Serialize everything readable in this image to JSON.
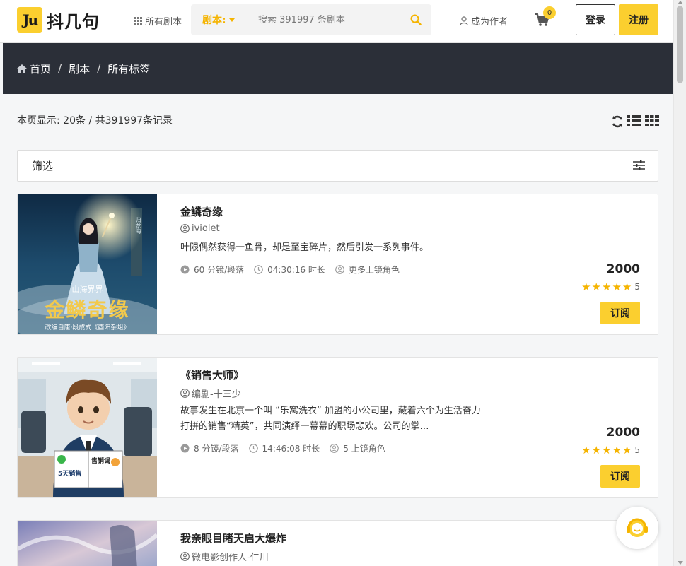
{
  "header": {
    "logo_mark": "Ju",
    "logo_text": "抖几句",
    "all_scripts_label": "所有剧本",
    "search_type": "剧本:",
    "search_placeholder": "搜索 391997 条剧本",
    "become_author_label": "成为作者",
    "cart_count": "0",
    "login_label": "登录",
    "register_label": "注册"
  },
  "breadcrumb": {
    "home": "首页",
    "level2": "剧本",
    "level3": "所有标签",
    "separator": "/"
  },
  "results_text": "本页显示: 20条 / 共391997条记录",
  "filter_label": "筛选",
  "cards": [
    {
      "title": "金鳞奇缘",
      "author": "iviolet",
      "description": "叶限偶然获得一鱼骨，却是至宝碎片，然后引发一系列事件。",
      "shots": "60 分镜/段落",
      "duration": "04:30:16 时长",
      "roles": "更多上镜角色",
      "price": "2000",
      "rating": "5",
      "subscribe_label": "订阅",
      "cover_caption_small": "山海界界",
      "cover_caption_big": "金鳞奇缘",
      "cover_caption_sub": "改编自唐·段成式《酉阳杂俎》",
      "cover_sign": "归龙海",
      "accent_color": "#f2c94c"
    },
    {
      "title": "《销售大师》",
      "author": "编剧-十三少",
      "description": "故事发生在北京一个叫 “乐窝洗衣” 加盟的小公司里，藏着六个为生活奋力打拼的销售“精英”，共同演绎一幕幕的职场悲欢。公司的掌…",
      "shots": "8 分镜/段落",
      "duration": "14:46:08 时长",
      "roles": "5 上镜角色",
      "price": "2000",
      "rating": "5",
      "subscribe_label": "订阅",
      "cover_book_left": "5天销售",
      "cover_book_right": "售销谒"
    },
    {
      "title": "我亲眼目睹天启大爆炸",
      "author": "微电影创作人-仁川"
    }
  ],
  "colors": {
    "accent": "#fbcf2f",
    "banner_bg": "#2b2f38",
    "page_bg": "#f5f6f7"
  }
}
